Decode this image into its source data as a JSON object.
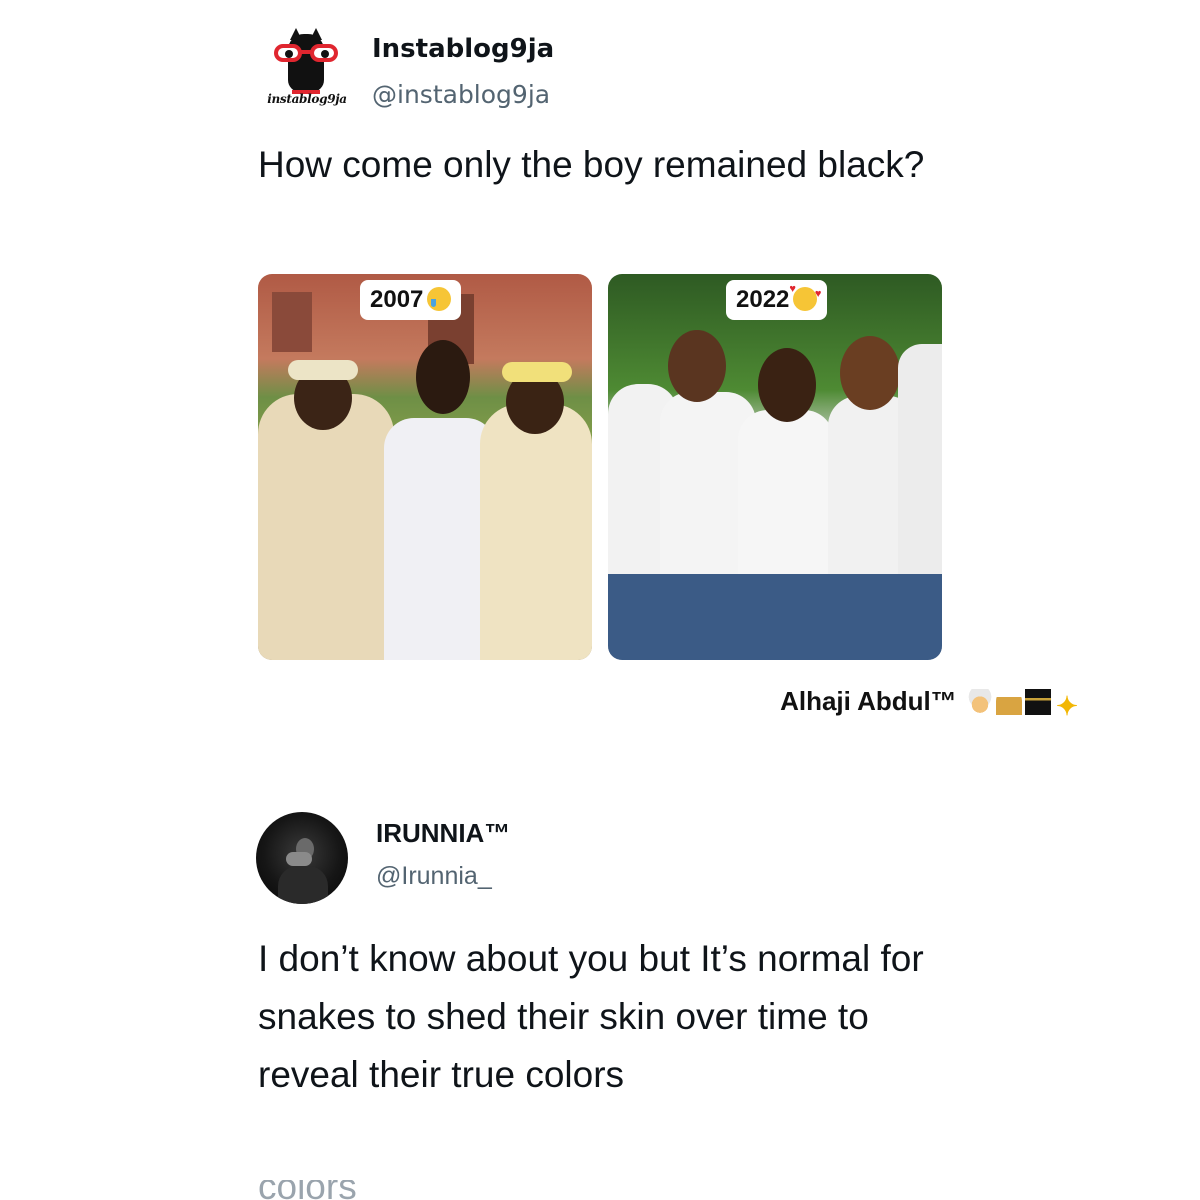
{
  "tweet1": {
    "logo_text": "instablog9ja",
    "display_name": "Instablog9ja",
    "handle": "@instablog9ja",
    "text": "How come only the boy remained black?",
    "media": [
      {
        "caption": "2007",
        "emoji": "crying-face-icon"
      },
      {
        "caption": "2022",
        "emoji": "smiling-face-with-hearts-icon"
      }
    ]
  },
  "signature": {
    "text": "Alhaji Abdul™",
    "emojis": [
      "turban-person-icon",
      "mosque-icon",
      "kaaba-icon",
      "sparkle-star-icon"
    ]
  },
  "tweet2": {
    "display_name": "IRUNNIA™",
    "handle": "@Irunnia_",
    "text": "I don’t know about you but It’s normal for snakes to shed their skin over time to reveal their true colors",
    "cut_off_text": "colors"
  },
  "colors": {
    "text": "#0f1419",
    "handle": "#536471",
    "brand_red": "#e0262f",
    "badge_bg": "#ffffff"
  }
}
